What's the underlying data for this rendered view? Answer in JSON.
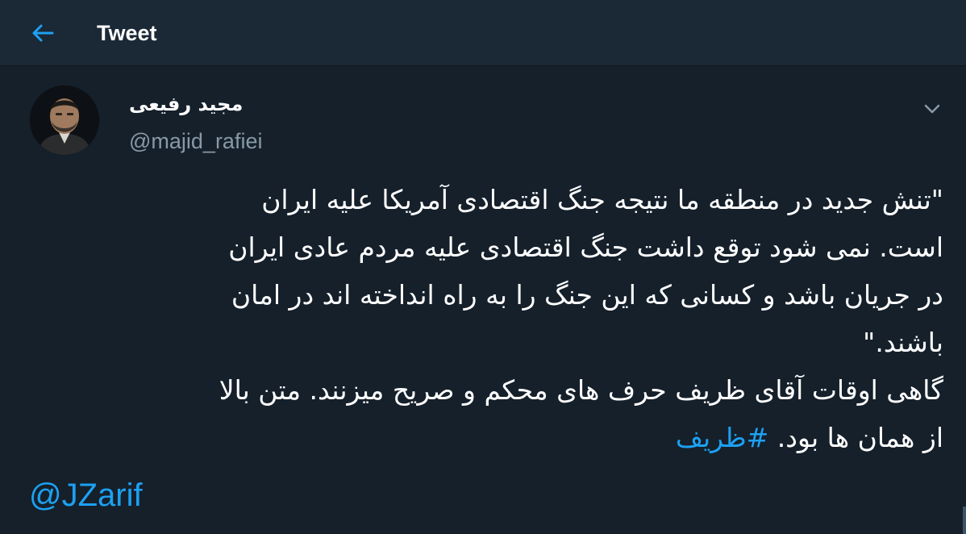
{
  "header": {
    "title": "Tweet",
    "back_icon": "arrow-left-icon",
    "accent": "#1da1f2"
  },
  "tweet": {
    "display_name": "مجید رفیعی",
    "handle": "@majid_rafiei",
    "menu_icon": "chevron-down-icon",
    "text_lines": [
      "\"تنش جدید در منطقه ما نتیجه جنگ اقتصادی آمریکا علیه ایران",
      "است. نمی شود توقع داشت جنگ اقتصادی علیه مردم عادی ایران",
      "در جریان باشد و کسانی که این جنگ را به راه انداخته اند در امان",
      "باشند.\"",
      "گاهی اوقات آقای ظریف حرف های محکم و صریح میزنند. متن بالا"
    ],
    "last_line_text": "از همان ها بود. ",
    "hashtag": "#ظریف",
    "mention": "@JZarif"
  },
  "colors": {
    "background": "#15202b",
    "header_background": "#1b2836",
    "secondary_text": "#8899a6",
    "link": "#1da1f2"
  }
}
